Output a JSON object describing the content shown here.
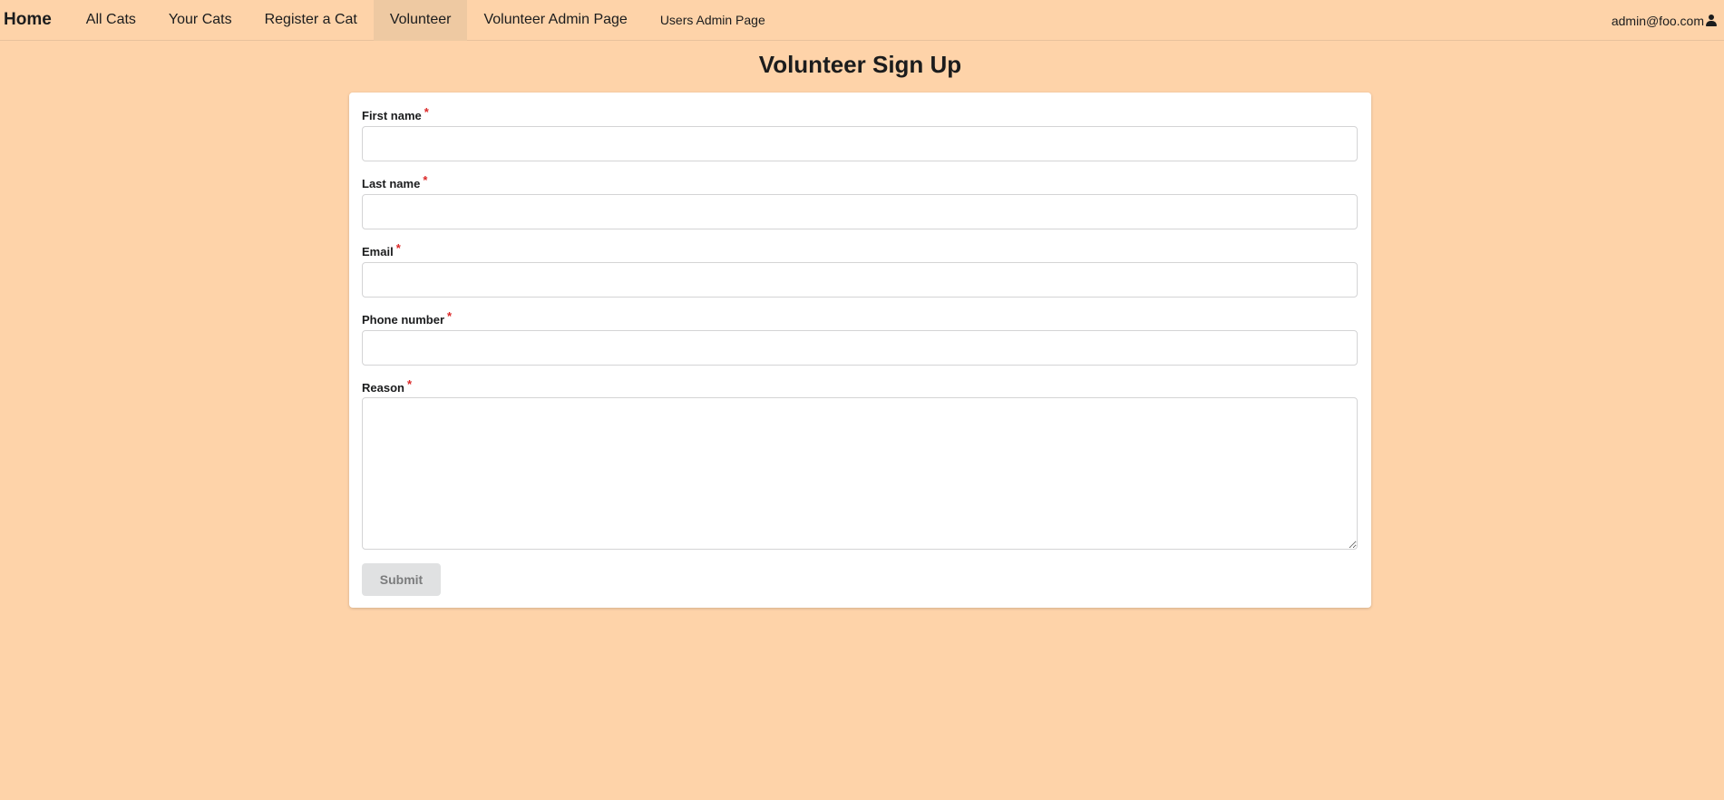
{
  "nav": {
    "home": "Home",
    "items": [
      {
        "label": "All Cats"
      },
      {
        "label": "Your Cats"
      },
      {
        "label": "Register a Cat"
      },
      {
        "label": "Volunteer",
        "active": true
      },
      {
        "label": "Volunteer Admin Page"
      },
      {
        "label": "Users Admin Page"
      }
    ],
    "user_email": "admin@foo.com",
    "user_icon": "user-icon"
  },
  "page": {
    "title": "Volunteer Sign Up"
  },
  "form": {
    "required_marker": "*",
    "fields": [
      {
        "label": "First name",
        "value": "",
        "placeholder": ""
      },
      {
        "label": "Last name",
        "value": "",
        "placeholder": ""
      },
      {
        "label": "Email",
        "value": "",
        "placeholder": ""
      },
      {
        "label": "Phone number",
        "value": "",
        "placeholder": ""
      },
      {
        "label": "Reason",
        "value": "",
        "placeholder": ""
      }
    ],
    "submit_label": "Submit"
  },
  "colors": {
    "background": "#fed3a9",
    "active_nav": "#eec9a2",
    "required": "#db2828"
  }
}
